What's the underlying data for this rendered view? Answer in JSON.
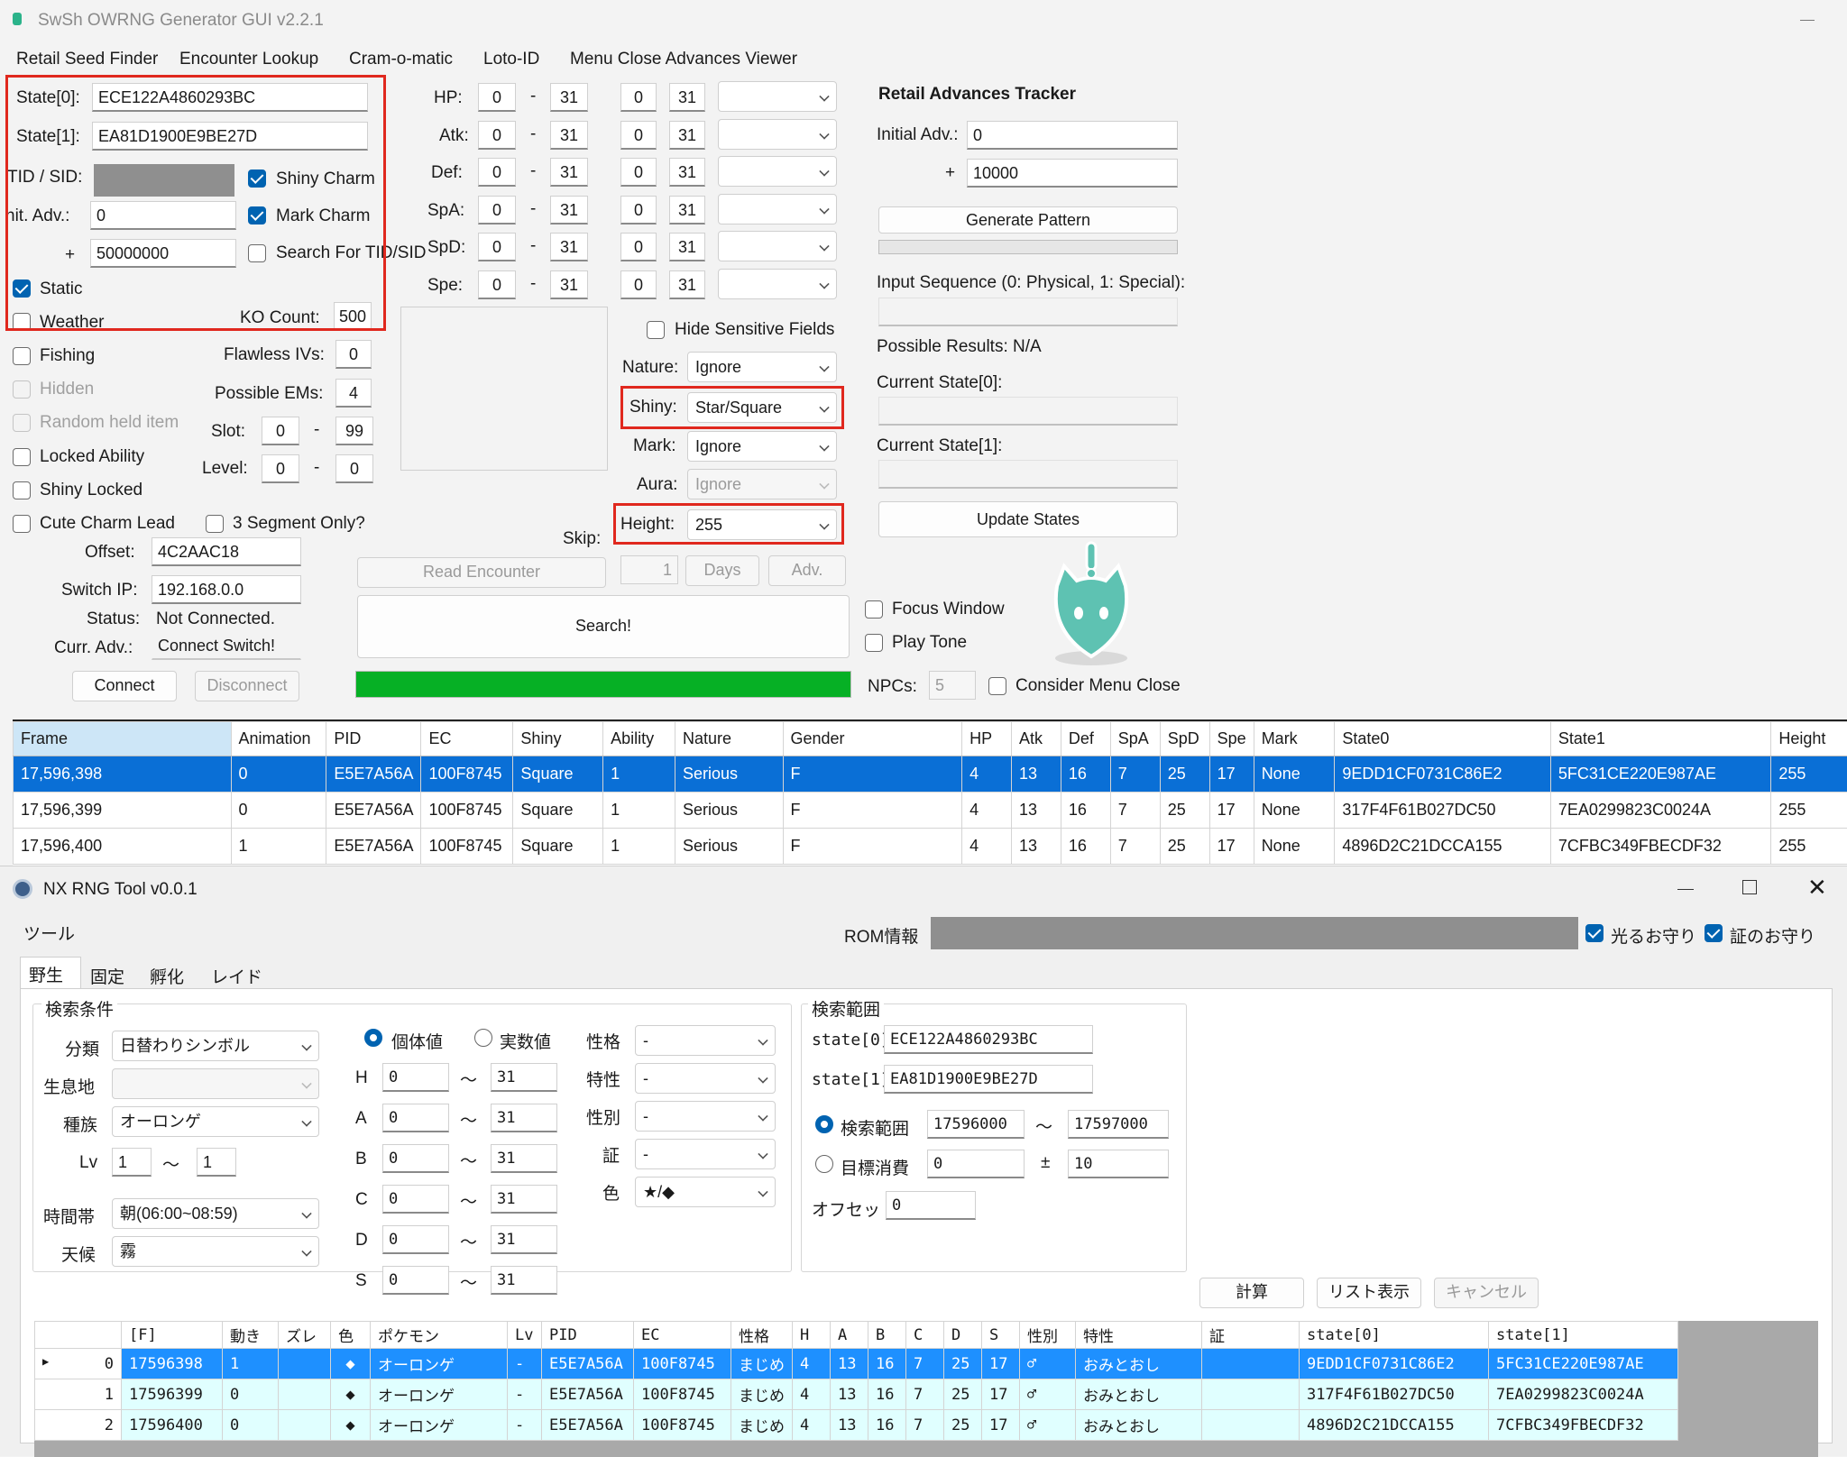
{
  "w1": {
    "title": "SwSh OWRNG Generator GUI v2.2.1",
    "menu": [
      "Retail Seed Finder",
      "Encounter Lookup",
      "Cram-o-matic",
      "Loto-ID",
      "Menu Close Advances Viewer"
    ],
    "state0_label": "State[0]:",
    "state0": "ECE122A4860293BC",
    "state1_label": "State[1]:",
    "state1": "EA81D1900E9BE27D",
    "tid_label": "TID / SID:",
    "init_adv_label": "nit. Adv.:",
    "init_adv": "0",
    "plus": "+",
    "adv_range": "50000000",
    "shiny_charm": "Shiny Charm",
    "mark_charm": "Mark Charm",
    "search_tid": "Search For TID/SID",
    "static": "Static",
    "weather": "Weather",
    "ko_label": "KO Count:",
    "ko": "500",
    "fishing": "Fishing",
    "flawless_label": "Flawless IVs:",
    "flawless": "0",
    "hidden": "Hidden",
    "pem_label": "Possible EMs:",
    "pem": "4",
    "random_held": "Random held item",
    "slot_label": "Slot:",
    "slot_min": "0",
    "slot_max": "99",
    "locked": "Locked Ability",
    "level_label": "Level:",
    "level_min": "0",
    "level_max": "0",
    "shiny_locked": "Shiny Locked",
    "cute": "Cute Charm Lead",
    "three_seg": "3 Segment Only?",
    "offset_label": "Offset:",
    "offset": "4C2AAC18",
    "ip_label": "Switch IP:",
    "ip": "192.168.0.0",
    "status_label": "Status:",
    "status": "Not Connected.",
    "curr_label": "Curr. Adv.:",
    "curr": "Connect Switch!",
    "connect": "Connect",
    "disconnect": "Disconnect",
    "dash": "-",
    "ivs": [
      {
        "l": "HP:",
        "a": "0",
        "b": "31",
        "c": "0",
        "d": "31"
      },
      {
        "l": "Atk:",
        "a": "0",
        "b": "31",
        "c": "0",
        "d": "31"
      },
      {
        "l": "Def:",
        "a": "0",
        "b": "31",
        "c": "0",
        "d": "31"
      },
      {
        "l": "SpA:",
        "a": "0",
        "b": "31",
        "c": "0",
        "d": "31"
      },
      {
        "l": "SpD:",
        "a": "0",
        "b": "31",
        "c": "0",
        "d": "31"
      },
      {
        "l": "Spe:",
        "a": "0",
        "b": "31",
        "c": "0",
        "d": "31"
      }
    ],
    "hide_sensitive": "Hide Sensitive Fields",
    "nature_label": "Nature:",
    "nature": "Ignore",
    "shiny_label": "Shiny:",
    "shiny": "Star/Square",
    "mark_label": "Mark:",
    "mark": "Ignore",
    "aura_label": "Aura:",
    "aura": "Ignore",
    "height_label": "Height:",
    "height": "255",
    "skip_label": "Skip:",
    "read_encounter": "Read Encounter",
    "skip_val": "1",
    "days": "Days",
    "adv": "Adv.",
    "search": "Search!",
    "focus": "Focus Window",
    "tone": "Play Tone",
    "npcs_label": "NPCs:",
    "npcs": "5",
    "consider": "Consider Menu Close",
    "tracker_title": "Retail Advances Tracker",
    "t_init_label": "Initial Adv.:",
    "t_init": "0",
    "t_plus": "+",
    "t_range": "10000",
    "gen_pattern": "Generate Pattern",
    "input_seq": "Input Sequence (0: Physical, 1: Special):",
    "possible": "Possible Results: N/A",
    "cur0": "Current State[0]:",
    "cur1": "Current State[1]:",
    "update": "Update States",
    "cols": [
      "Frame",
      "Animation",
      "PID",
      "EC",
      "Shiny",
      "Ability",
      "Nature",
      "Gender",
      "HP",
      "Atk",
      "Def",
      "SpA",
      "SpD",
      "Spe",
      "Mark",
      "State0",
      "State1",
      "Height"
    ],
    "rows": [
      [
        "17,596,398",
        "0",
        "E5E7A56A",
        "100F8745",
        "Square",
        "1",
        "Serious",
        "F",
        "4",
        "13",
        "16",
        "7",
        "25",
        "17",
        "None",
        "9EDD1CF0731C86E2",
        "5FC31CE220E987AE",
        "255"
      ],
      [
        "17,596,399",
        "0",
        "E5E7A56A",
        "100F8745",
        "Square",
        "1",
        "Serious",
        "F",
        "4",
        "13",
        "16",
        "7",
        "25",
        "17",
        "None",
        "317F4F61B027DC50",
        "7EA0299823C0024A",
        "255"
      ],
      [
        "17,596,400",
        "1",
        "E5E7A56A",
        "100F8745",
        "Square",
        "1",
        "Serious",
        "F",
        "4",
        "13",
        "16",
        "7",
        "25",
        "17",
        "None",
        "4896D2C21DCCA155",
        "7CFBC349FBECDF32",
        "255"
      ]
    ]
  },
  "w2": {
    "title": "NX RNG Tool v0.0.1",
    "menu": "ツール",
    "rom_label": "ROM情報",
    "hikaru": "光るお守り",
    "akashi": "証のお守り",
    "tabs": [
      "野生",
      "固定",
      "孵化",
      "レイド"
    ],
    "cond_title": "検索条件",
    "bunrui_label": "分類",
    "bunrui": "日替わりシンボル",
    "habitat_label": "生息地",
    "species_label": "種族",
    "species": "オーロンゲ",
    "lv_label": "Lv",
    "lv_min": "1",
    "lv_max": "1",
    "tilde": "〜",
    "time_label": "時間帯",
    "time": "朝(06:00~08:59)",
    "weather_label": "天候",
    "weather": "霧",
    "iv_radio": "個体値",
    "stat_radio": "実数値",
    "ivs": [
      {
        "l": "H",
        "a": "0",
        "b": "31"
      },
      {
        "l": "A",
        "a": "0",
        "b": "31"
      },
      {
        "l": "B",
        "a": "0",
        "b": "31"
      },
      {
        "l": "C",
        "a": "0",
        "b": "31"
      },
      {
        "l": "D",
        "a": "0",
        "b": "31"
      },
      {
        "l": "S",
        "a": "0",
        "b": "31"
      }
    ],
    "nature_label": "性格",
    "nature": "-",
    "ability_label": "特性",
    "ability": "-",
    "gender_label": "性別",
    "gender": "-",
    "mark_label": "証",
    "mark": "-",
    "color_label": "色",
    "color": "★/◆",
    "range_title": "検索範囲",
    "s0_label": "state[0]",
    "s0": "ECE122A4860293BC",
    "s1_label": "state[1]",
    "s1": "EA81D1900E9BE27D",
    "range_radio": "検索範囲",
    "range_min": "17596000",
    "range_max": "17597000",
    "target_radio": "目標消費",
    "target": "0",
    "pm": "±",
    "target_tol": "10",
    "offset_label": "オフセット",
    "offset": "0",
    "calc": "計算",
    "list": "リスト表示",
    "cancel": "キャンセル",
    "cols": [
      "[F]",
      "動き",
      "ズレ",
      "色",
      "ポケモン",
      "Lv",
      "PID",
      "EC",
      "性格",
      "H",
      "A",
      "B",
      "C",
      "D",
      "S",
      "性別",
      "特性",
      "証",
      "state[0]",
      "state[1]"
    ],
    "rows": [
      {
        "idx": "0",
        "cells": [
          "17596398",
          "1",
          "",
          "◆",
          "オーロンゲ",
          "-",
          "E5E7A56A",
          "100F8745",
          "まじめ",
          "4",
          "13",
          "16",
          "7",
          "25",
          "17",
          "♂",
          "おみとおし",
          "",
          "9EDD1CF0731C86E2",
          "5FC31CE220E987AE"
        ]
      },
      {
        "idx": "1",
        "cells": [
          "17596399",
          "0",
          "",
          "◆",
          "オーロンゲ",
          "-",
          "E5E7A56A",
          "100F8745",
          "まじめ",
          "4",
          "13",
          "16",
          "7",
          "25",
          "17",
          "♂",
          "おみとおし",
          "",
          "317F4F61B027DC50",
          "7EA0299823C0024A"
        ]
      },
      {
        "idx": "2",
        "cells": [
          "17596400",
          "0",
          "",
          "◆",
          "オーロンゲ",
          "-",
          "E5E7A56A",
          "100F8745",
          "まじめ",
          "4",
          "13",
          "16",
          "7",
          "25",
          "17",
          "♂",
          "おみとおし",
          "",
          "4896D2C21DCCA155",
          "7CFBC349FBECDF32"
        ]
      }
    ]
  }
}
